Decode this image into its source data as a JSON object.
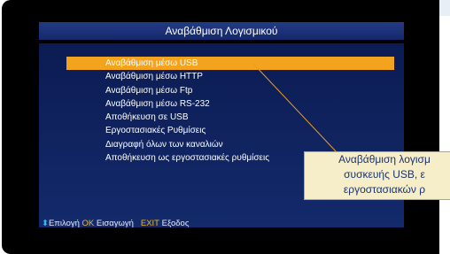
{
  "title": "Αναβάθμιση Λογισμικού",
  "menu": {
    "items": [
      {
        "label": "Αναβάθμιση μέσω USB",
        "selected": true
      },
      {
        "label": "Αναβάθμιση μέσω HTTP",
        "selected": false
      },
      {
        "label": "Αναβάθμιση μέσω Ftp",
        "selected": false
      },
      {
        "label": "Αναβάθμιση μέσω RS-232",
        "selected": false
      },
      {
        "label": "Αποθήκευση σε USB",
        "selected": false
      },
      {
        "label": "Εργοστασιακές Ρυθμίσεις",
        "selected": false
      },
      {
        "label": "Διαγραφή όλων των καναλιών",
        "selected": false
      },
      {
        "label": "Αποθήκευση ως εργοστασιακές ρυθμίσεις",
        "selected": false
      }
    ]
  },
  "footer": {
    "select_icon": "up-down-arrows-icon",
    "select_label": "Επιλογή",
    "ok_key": "OK",
    "ok_label": "Εισαγωγή",
    "exit_key": "EXIT",
    "exit_label": "Εξοδος"
  },
  "callout": {
    "lines": [
      "Αναβάθμιση λογισμ",
      "συσκευής USB,  ε",
      "εργοστασιακών ρ"
    ]
  },
  "colors": {
    "highlight": "#f3a31d",
    "callout_border": "#ee9b22",
    "callout_bg": "#f6edc9"
  }
}
